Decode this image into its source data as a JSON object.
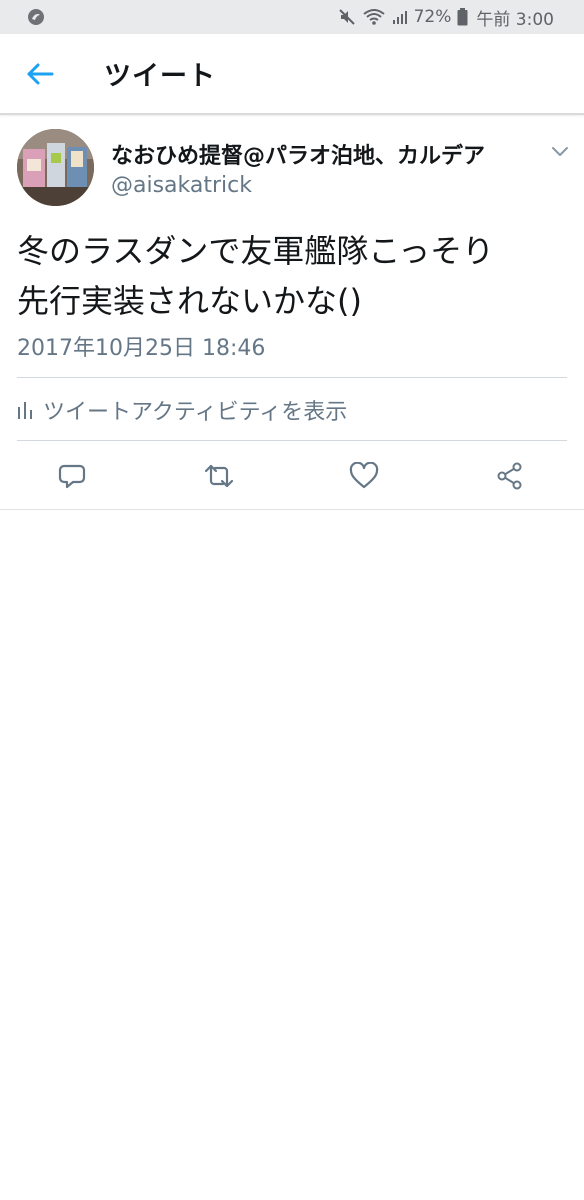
{
  "status_bar": {
    "battery_percent": "72%",
    "time": "午前 3:00",
    "icons": [
      "app-notification-icon",
      "mute-icon",
      "wifi-icon",
      "signal-icon",
      "battery-icon"
    ]
  },
  "app_bar": {
    "title": "ツイート",
    "back_icon": "back-arrow-icon"
  },
  "tweet": {
    "display_name": "なおひめ提督@パラオ泊地、カルデア",
    "handle": "@aisakatrick",
    "text_lines": [
      "冬のラスダンで友軍艦隊こっそり",
      "先行実装されないかな()"
    ],
    "timestamp": "2017年10月25日 18:46",
    "activity_label": "ツイートアクティビティを表示"
  },
  "actions": [
    "reply-icon",
    "retweet-icon",
    "like-icon",
    "share-icon"
  ],
  "colors": {
    "accent": "#1da1f2",
    "secondary_text": "#657786",
    "divider": "#d3d9df",
    "status_bar_bg": "#e9eaec"
  }
}
